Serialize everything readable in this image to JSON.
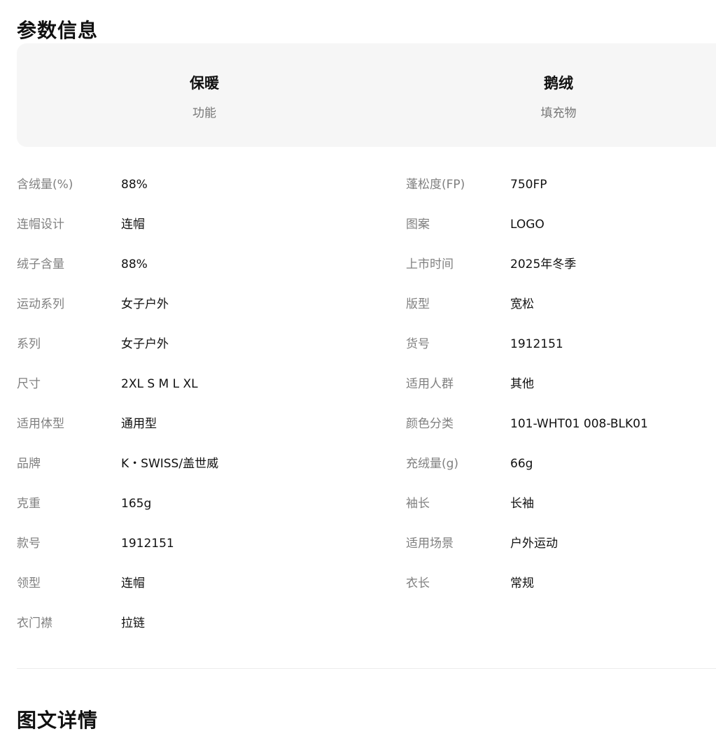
{
  "params": {
    "title": "参数信息",
    "highlights": [
      {
        "value": "保暖",
        "label": "功能"
      },
      {
        "value": "鹅绒",
        "label": "填充物"
      }
    ],
    "rows": [
      {
        "left": {
          "label": "含绒量(%)",
          "value": "88%"
        },
        "right": {
          "label": "蓬松度(FP)",
          "value": "750FP"
        }
      },
      {
        "left": {
          "label": "连帽设计",
          "value": "连帽"
        },
        "right": {
          "label": "图案",
          "value": "LOGO"
        }
      },
      {
        "left": {
          "label": "绒子含量",
          "value": "88%"
        },
        "right": {
          "label": "上市时间",
          "value": "2025年冬季"
        }
      },
      {
        "left": {
          "label": "运动系列",
          "value": "女子户外"
        },
        "right": {
          "label": "版型",
          "value": "宽松"
        }
      },
      {
        "left": {
          "label": "系列",
          "value": "女子户外"
        },
        "right": {
          "label": "货号",
          "value": "1912151"
        }
      },
      {
        "left": {
          "label": "尺寸",
          "value": "2XL S M L XL"
        },
        "right": {
          "label": "适用人群",
          "value": "其他"
        }
      },
      {
        "left": {
          "label": "适用体型",
          "value": "通用型"
        },
        "right": {
          "label": "颜色分类",
          "value": "101-WHT01 008-BLK01"
        }
      },
      {
        "left": {
          "label": "品牌",
          "value": "K・SWISS/盖世威"
        },
        "right": {
          "label": "充绒量(g)",
          "value": "66g"
        }
      },
      {
        "left": {
          "label": "克重",
          "value": "165g"
        },
        "right": {
          "label": "袖长",
          "value": "长袖"
        }
      },
      {
        "left": {
          "label": "款号",
          "value": "1912151"
        },
        "right": {
          "label": "适用场景",
          "value": "户外运动"
        }
      },
      {
        "left": {
          "label": "领型",
          "value": "连帽"
        },
        "right": {
          "label": "衣长",
          "value": "常规"
        }
      },
      {
        "left": {
          "label": "衣门襟",
          "value": "拉链"
        }
      }
    ]
  },
  "detail": {
    "title": "图文详情"
  },
  "colors": {
    "card_background": "#f6f6f6",
    "label_text": "#808080",
    "value_text": "#111111",
    "highlight_sub_text": "#777777"
  }
}
